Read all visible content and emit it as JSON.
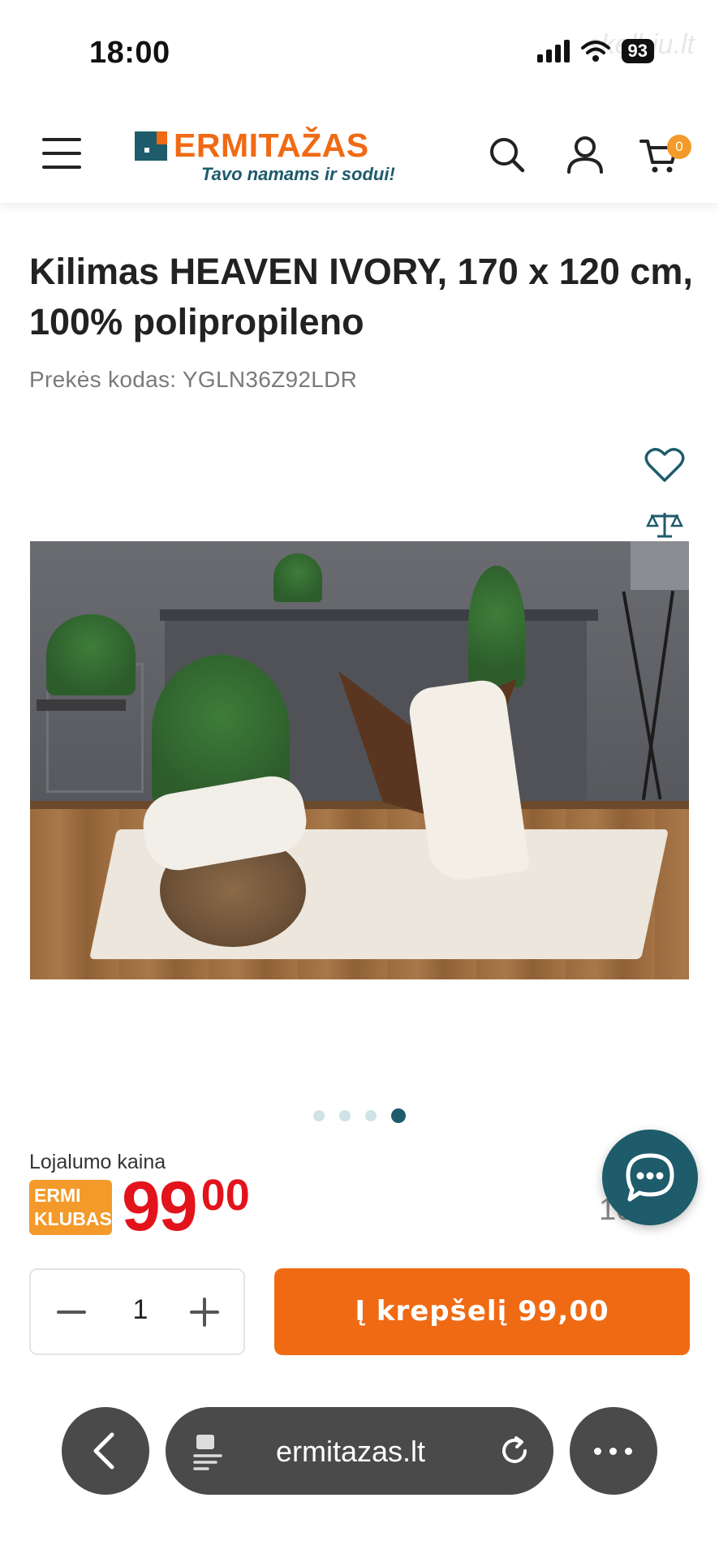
{
  "status_bar": {
    "time": "18:00",
    "battery": "93",
    "watermark": "skelbiu.lt"
  },
  "header": {
    "logo_text": "ERMITAŽAS",
    "logo_tagline": "Tavo namams ir sodui!",
    "cart_count": "0",
    "brand_color": "#f06a14",
    "secondary_color": "#1e5b6b"
  },
  "product": {
    "title": "Kilimas HEAVEN IVORY, 170 x 120 cm, 100% polipropileno",
    "sku_label": "Prekės kodas:",
    "sku_value": "YGLN36Z92LDR",
    "image_count": 4,
    "active_image": 4
  },
  "price": {
    "loyalty_label": "Lojalumo kaina",
    "badge_line1": "ERMI",
    "badge_line2": "KLUBAS",
    "integer": "99",
    "decimals": "00",
    "old_price_partial": "10 .0",
    "price_color": "#e3131b"
  },
  "purchase": {
    "quantity": "1",
    "add_to_cart_label": "Į krepšelį  99,00"
  },
  "browser": {
    "url": "ermitazas.lt"
  },
  "icons": [
    "menu-icon",
    "search-icon",
    "user-icon",
    "cart-icon",
    "heart-icon",
    "compare-scale-icon",
    "chat-icon",
    "back-chevron-icon",
    "tab-icon",
    "reload-icon",
    "more-icon"
  ]
}
